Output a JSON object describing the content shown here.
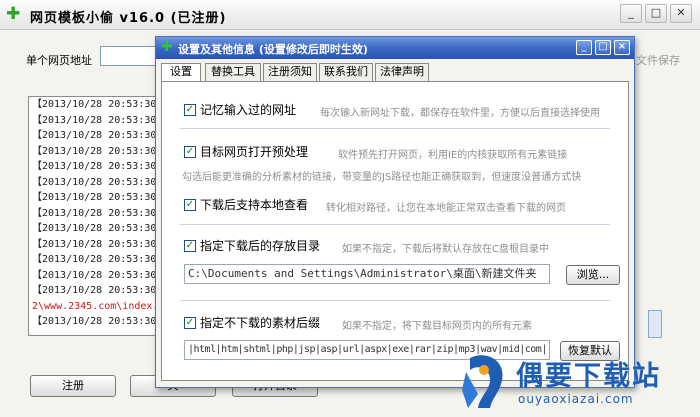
{
  "main": {
    "title": "网页模板小偷 v16.0 (已注册)",
    "url_label": "单个网页地址",
    "url_value": "",
    "save_hint": "文件保存",
    "log_rows": [
      "【2013/10/28 20:53:30】",
      "【2013/10/28 20:53:30】",
      "【2013/10/28 20:53:30】",
      "【2013/10/28 20:53:30】",
      "【2013/10/28 20:53:30】",
      "【2013/10/28 20:53:30】",
      "【2013/10/28 20:53:30】",
      "【2013/10/28 20:53:30】",
      "【2013/10/28 20:53:30】",
      "【2013/10/28 20:53:30】",
      "【2013/10/28 20:53:30】",
      "【2013/10/28 20:53:30】",
      "【2013/10/28 20:53:30】",
      "2\\www.2345.com\\index.h",
      "【2013/10/28 20:53:30】"
    ],
    "buttons": {
      "register": "注册",
      "btn2": "关",
      "btn3": "打开目录"
    },
    "min_glyph": "_",
    "max_glyph": "□",
    "close_glyph": "✕"
  },
  "dialog": {
    "title": "设置及其他信息 (设置修改后即时生效)",
    "min_glyph": "_",
    "max_glyph": "□",
    "close_glyph": "×",
    "tabs": [
      "设置",
      "替换工具",
      "注册须知",
      "联系我们",
      "法律声明"
    ],
    "options": {
      "remember_url": {
        "label": "记忆输入过的网址",
        "hint": "每次输入新网址下载，都保存在软件里，方便以后直接选择使用",
        "checked": true
      },
      "preprocess": {
        "label": "目标网页打开预处理",
        "hint": "软件预先打开网页，利用IE的内核获取所有元素链接",
        "hint2": "勾选后能更准确的分析素材的链接，带变量的JS路径也能正确获取到，但速度没普通方式快",
        "checked": true
      },
      "local_view": {
        "label": "下载后支持本地查看",
        "hint": "转化相对路径，让您在本地能正常双击查看下载的网页",
        "checked": true
      },
      "save_dir": {
        "label": "指定下载后的存放目录",
        "hint": "如果不指定，下载后将默认存放在C盘根目录中",
        "path": "C:\\Documents and Settings\\Administrator\\桌面\\新建文件夹",
        "browse": "浏览...",
        "checked": true
      },
      "exclude": {
        "label": "指定不下载的素材后缀",
        "hint": "如果不指定，将下载目标网页内的所有元素",
        "exts": "|html|htm|shtml|php|jsp|asp|url|aspx|exe|rar|zip|mp3|wav|mid|com|",
        "reset": "恢复默认",
        "checked": true
      }
    },
    "check_glyph": "✓"
  },
  "watermark": {
    "text": "偶要下载站",
    "url": "ouyaoxiazai.com"
  },
  "colors": {
    "title_blue": "#3765c2",
    "hint_gray": "#8f8f8f",
    "log_red": "#d41313",
    "brand_blue": "#1f5fb3"
  }
}
